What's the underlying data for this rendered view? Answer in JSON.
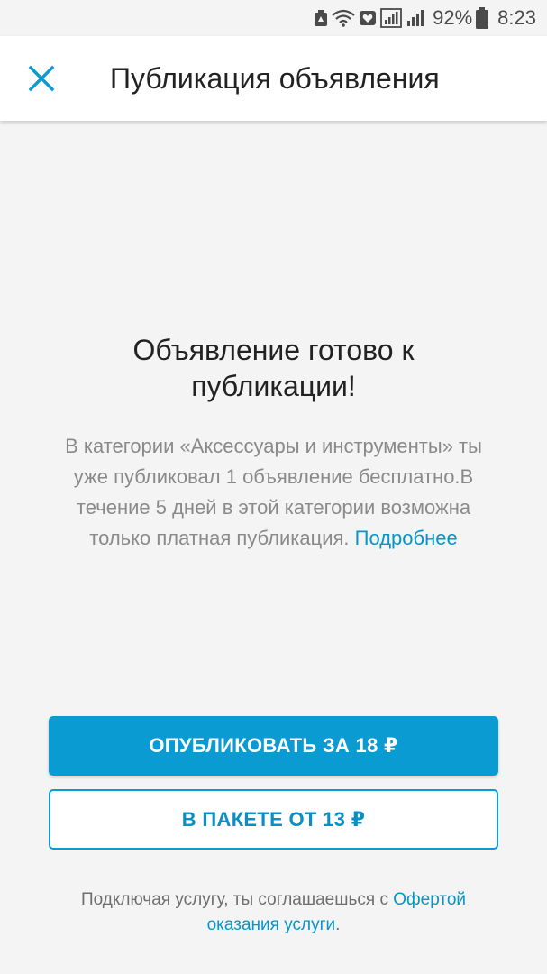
{
  "status_bar": {
    "battery_percent": "92%",
    "time": "8:23",
    "icons": [
      "alert-icon",
      "wifi-icon",
      "heart-icon",
      "signal-icon",
      "signal-icon-2",
      "battery-icon"
    ]
  },
  "app_bar": {
    "title": "Публикация объявления",
    "close_icon": "close-icon"
  },
  "content": {
    "heading": "Объявление готово к публикации!",
    "description": "В категории «Аксессуары и инструменты» ты уже публиковал 1 объявление бесплатно.В течение 5 дней в этой категории возможна только платная публикация. ",
    "more_link": "Подробнее"
  },
  "actions": {
    "publish_label": "ОПУБЛИКОВАТЬ ЗА 18 ₽",
    "package_label": "В ПАКЕТЕ ОТ 13 ₽"
  },
  "footer": {
    "text": "Подключая услугу, ты соглашаешься с ",
    "offer_link": "Офертой оказания услуги",
    "end": "."
  },
  "colors": {
    "accent": "#0a9bd3",
    "link": "#0596c9",
    "background": "#f4f4f4"
  }
}
